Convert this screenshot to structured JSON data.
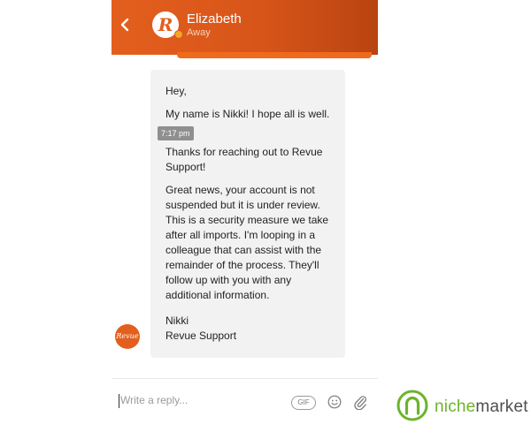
{
  "header": {
    "contact_name": "Elizabeth",
    "contact_status": "Away",
    "avatar_letter": "R",
    "accent_color": "#e35f1d"
  },
  "conversation": {
    "timestamp": "7:17 pm",
    "sender_avatar_text": "Revue",
    "paragraphs": [
      "Hey,",
      "My name is Nikki! I hope all is well.",
      "Thanks for reaching out to Revue Support!",
      "Great news, your account is not suspended but it is under review. This is a security measure we take after all imports. I'm looping in a colleague that can assist with the remainder of the process. They'll follow up with you with any additional information.",
      "Nikki\nRevue Support"
    ]
  },
  "composer": {
    "placeholder": "Write a reply...",
    "gif_label": "GIF"
  },
  "watermark": {
    "part1": "niche",
    "part2": "market",
    "brand_color": "#6cb42b"
  }
}
